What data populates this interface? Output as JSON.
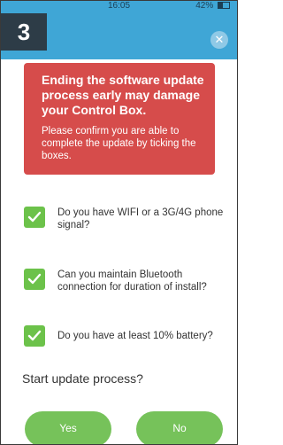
{
  "status_bar": {
    "time": "16:05",
    "battery": "42%"
  },
  "header": {
    "step": "3",
    "close_glyph": "✕"
  },
  "alert": {
    "title": "Ending the software update process early may damage your Control Box.",
    "body": "Please confirm you are able to complete the update by ticking the boxes."
  },
  "checklist": [
    {
      "label": "Do you have WIFI or a 3G/4G phone signal?",
      "checked": true
    },
    {
      "label": "Can you maintain Bluetooth connection for duration of install?",
      "checked": true
    },
    {
      "label": "Do you have at least 10% battery?",
      "checked": true
    }
  ],
  "prompt": "Start update process?",
  "buttons": {
    "yes": "Yes",
    "no": "No"
  },
  "colors": {
    "header": "#3fa6d6",
    "alert": "#d64c4b",
    "accent_green": "#76c25a",
    "badge": "#2d3c47"
  }
}
